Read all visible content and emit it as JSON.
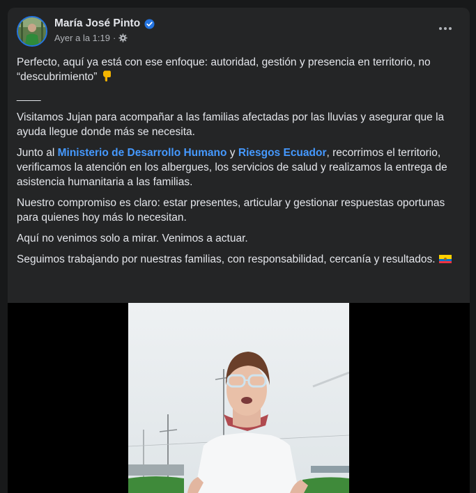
{
  "post": {
    "author": "María José Pinto",
    "timestamp": "Ayer a la 1:19",
    "separator": "·",
    "privacy_icon": "gear-icon",
    "more_icon": "more-options-icon",
    "verified_icon": "verified-badge-icon"
  },
  "body": {
    "p1": "Perfecto, aquí ya está con ese enfoque: autoridad, gestión y presencia en territorio, no “descubrimiento”",
    "p1_emoji": "pointing-down-emoji",
    "rule": "____",
    "p2": "Visitamos Jujan para acompañar a las familias afectadas por las lluvias y asegurar que la ayuda llegue donde más se necesita.",
    "p3_pre": "Junto al ",
    "p3_link1": "Ministerio de Desarrollo Humano",
    "p3_mid": " y ",
    "p3_link2": "Riesgos Ecuador",
    "p3_post": ", recorrimos el territorio, verificamos la atención en los albergues, los servicios de salud y realizamos la entrega de asistencia humanitaria a las familias.",
    "p4": "Nuestro compromiso es claro: estar presentes, articular y gestionar respuestas oportunas para quienes hoy más lo necesitan.",
    "p5": "Aquí no venimos solo a mirar. Venimos a actuar.",
    "p6": "Seguimos trabajando por nuestras familias, con responsabilidad, cercanía y resultados.",
    "p6_emoji": "ecuador-flag-emoji"
  },
  "colors": {
    "page_bg": "#18191a",
    "card_bg": "#242526",
    "text": "#e4e6eb",
    "secondary_text": "#b0b3b8",
    "link": "#4599ff",
    "verified": "#2374e1"
  }
}
